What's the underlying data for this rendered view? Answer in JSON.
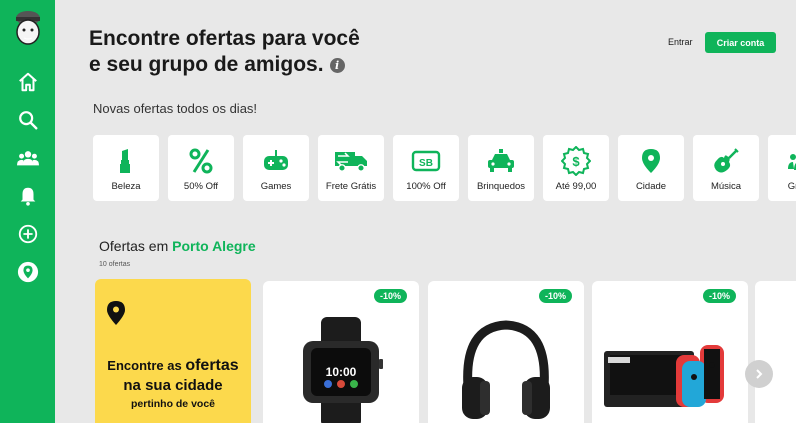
{
  "header": {
    "title_line1": "Encontre ofertas para você",
    "title_line2": "e seu grupo de amigos.",
    "info_glyph": "i",
    "login_label": "Entrar",
    "signup_label": "Criar conta",
    "subtitle": "Novas ofertas todos os dias!"
  },
  "sidebar": {
    "items": [
      {
        "icon": "home-icon"
      },
      {
        "icon": "search-icon"
      },
      {
        "icon": "group-icon"
      },
      {
        "icon": "bell-icon"
      },
      {
        "icon": "add-circle-icon"
      },
      {
        "icon": "location-pin-icon"
      }
    ]
  },
  "categories": [
    {
      "label": "Beleza",
      "icon": "lipstick-icon"
    },
    {
      "label": "50% Off",
      "icon": "percent-icon"
    },
    {
      "label": "Games",
      "icon": "gamepad-icon"
    },
    {
      "label": "Frete Grátis",
      "icon": "truck-icon"
    },
    {
      "label": "100% Off",
      "icon": "sb-icon"
    },
    {
      "label": "Brinquedos",
      "icon": "toy-car-icon"
    },
    {
      "label": "Até 99,00",
      "icon": "dollar-badge-icon"
    },
    {
      "label": "Cidade",
      "icon": "map-pin-icon"
    },
    {
      "label": "Música",
      "icon": "guitar-icon"
    },
    {
      "label": "Grupo",
      "icon": "people-icon"
    }
  ],
  "offers": {
    "title_prefix": "Ofertas em ",
    "city": "Porto Alegre",
    "count": "10 ofertas",
    "promo": {
      "line1_a": "Encontre as ",
      "line1_b": "ofertas",
      "line2": "na sua cidade",
      "line3": "pertinho de você"
    },
    "cards": [
      {
        "discount": "-10%",
        "product": "smartwatch",
        "screen_text": "10:00"
      },
      {
        "discount": "-10%",
        "product": "headphones"
      },
      {
        "discount": "-10%",
        "product": "game-console"
      }
    ]
  },
  "colors": {
    "brand_green": "#0fb45a",
    "promo_yellow": "#fcd94c",
    "background": "#e8e8e8"
  }
}
